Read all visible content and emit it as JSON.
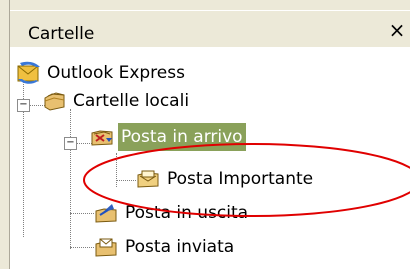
{
  "window": {
    "title": "Cartelle",
    "close_label": "×"
  },
  "tree": {
    "root": "Outlook Express",
    "local_folders": "Cartelle locali",
    "inbox": "Posta in arrivo",
    "important": "Posta Importante",
    "outbox": "Posta in uscita",
    "sent": "Posta inviata"
  },
  "colors": {
    "selection": "#8aa15a",
    "annotation": "#e00000"
  }
}
